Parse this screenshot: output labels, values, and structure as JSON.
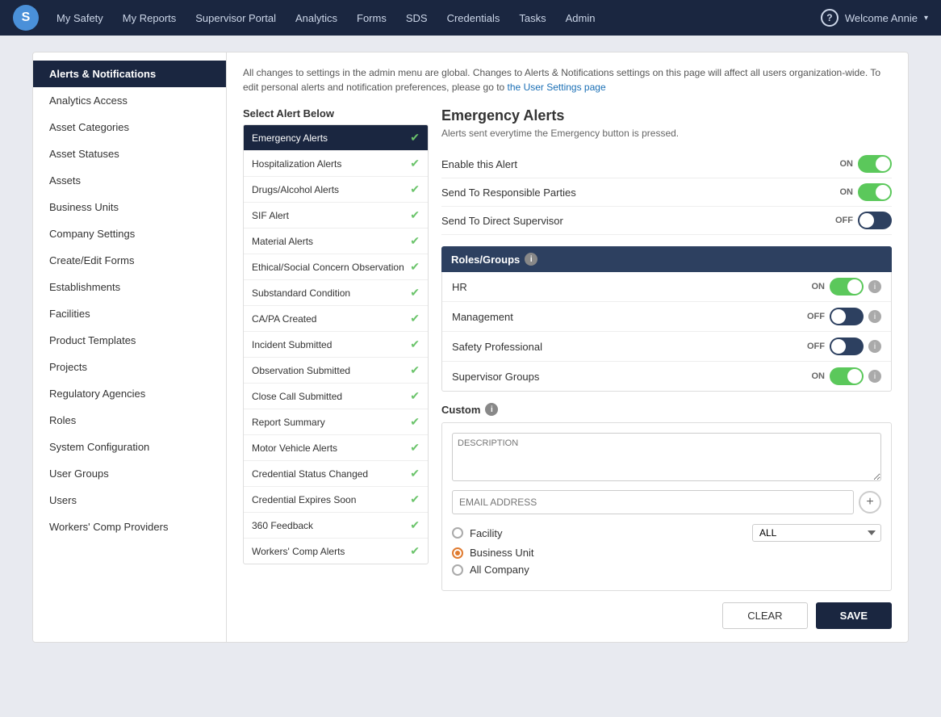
{
  "nav": {
    "logo": "S",
    "items": [
      "My Safety",
      "My Reports",
      "Supervisor Portal",
      "Analytics",
      "Forms",
      "SDS",
      "Credentials",
      "Tasks",
      "Admin"
    ],
    "help": "?",
    "welcome": "Welcome Annie",
    "caret": "▾"
  },
  "sidebar": {
    "items": [
      "Alerts & Notifications",
      "Analytics Access",
      "Asset Categories",
      "Asset Statuses",
      "Assets",
      "Business Units",
      "Company Settings",
      "Create/Edit Forms",
      "Establishments",
      "Facilities",
      "Product Templates",
      "Projects",
      "Regulatory Agencies",
      "Roles",
      "System Configuration",
      "User Groups",
      "Users",
      "Workers' Comp Providers"
    ],
    "active_index": 0
  },
  "info_banner": {
    "text_before": "All changes to settings in the admin menu are global. Changes to Alerts & Notifications settings on this page will affect all users organization-wide. To edit personal alerts and notification preferences, please go to ",
    "link_text": "the User Settings page",
    "text_after": ""
  },
  "select_alert_label": "Select Alert Below",
  "alerts": [
    {
      "name": "Emergency Alerts",
      "active": true,
      "checked": true
    },
    {
      "name": "Hospitalization Alerts",
      "active": false,
      "checked": true
    },
    {
      "name": "Drugs/Alcohol Alerts",
      "active": false,
      "checked": true
    },
    {
      "name": "SIF Alert",
      "active": false,
      "checked": true
    },
    {
      "name": "Material Alerts",
      "active": false,
      "checked": true
    },
    {
      "name": "Ethical/Social Concern Observation",
      "active": false,
      "checked": true
    },
    {
      "name": "Substandard Condition",
      "active": false,
      "checked": true
    },
    {
      "name": "CA/PA Created",
      "active": false,
      "checked": true
    },
    {
      "name": "Incident Submitted",
      "active": false,
      "checked": true
    },
    {
      "name": "Observation Submitted",
      "active": false,
      "checked": true
    },
    {
      "name": "Close Call Submitted",
      "active": false,
      "checked": true
    },
    {
      "name": "Report Summary",
      "active": false,
      "checked": true
    },
    {
      "name": "Motor Vehicle Alerts",
      "active": false,
      "checked": true
    },
    {
      "name": "Credential Status Changed",
      "active": false,
      "checked": true
    },
    {
      "name": "Credential Expires Soon",
      "active": false,
      "checked": true
    },
    {
      "name": "360 Feedback",
      "active": false,
      "checked": true
    },
    {
      "name": "Workers' Comp Alerts",
      "active": false,
      "checked": true
    }
  ],
  "detail": {
    "title": "Emergency Alerts",
    "subtitle": "Alerts sent everytime the Emergency button is pressed.",
    "enable_label": "Enable this Alert",
    "enable_state": "ON",
    "enable_on": true,
    "send_responsible_label": "Send To Responsible Parties",
    "send_responsible_state": "ON",
    "send_responsible_on": true,
    "send_supervisor_label": "Send To Direct Supervisor",
    "send_supervisor_state": "OFF",
    "send_supervisor_on": false
  },
  "roles_groups": {
    "header": "Roles/Groups",
    "rows": [
      {
        "name": "HR",
        "state": "ON",
        "on": true
      },
      {
        "name": "Management",
        "state": "OFF",
        "on": false
      },
      {
        "name": "Safety Professional",
        "state": "OFF",
        "on": false
      },
      {
        "name": "Supervisor Groups",
        "state": "ON",
        "on": true
      }
    ]
  },
  "custom": {
    "header": "Custom",
    "description_placeholder": "DESCRIPTION",
    "email_placeholder": "EMAIL ADDRESS",
    "radio_options": [
      {
        "label": "Facility",
        "type": "unselected"
      },
      {
        "label": "Business Unit",
        "type": "orange_selected"
      },
      {
        "label": "All Company",
        "type": "unselected"
      }
    ],
    "facility_select_default": "ALL",
    "facility_options": [
      "ALL"
    ]
  },
  "buttons": {
    "clear": "CLEAR",
    "save": "SAVE"
  }
}
